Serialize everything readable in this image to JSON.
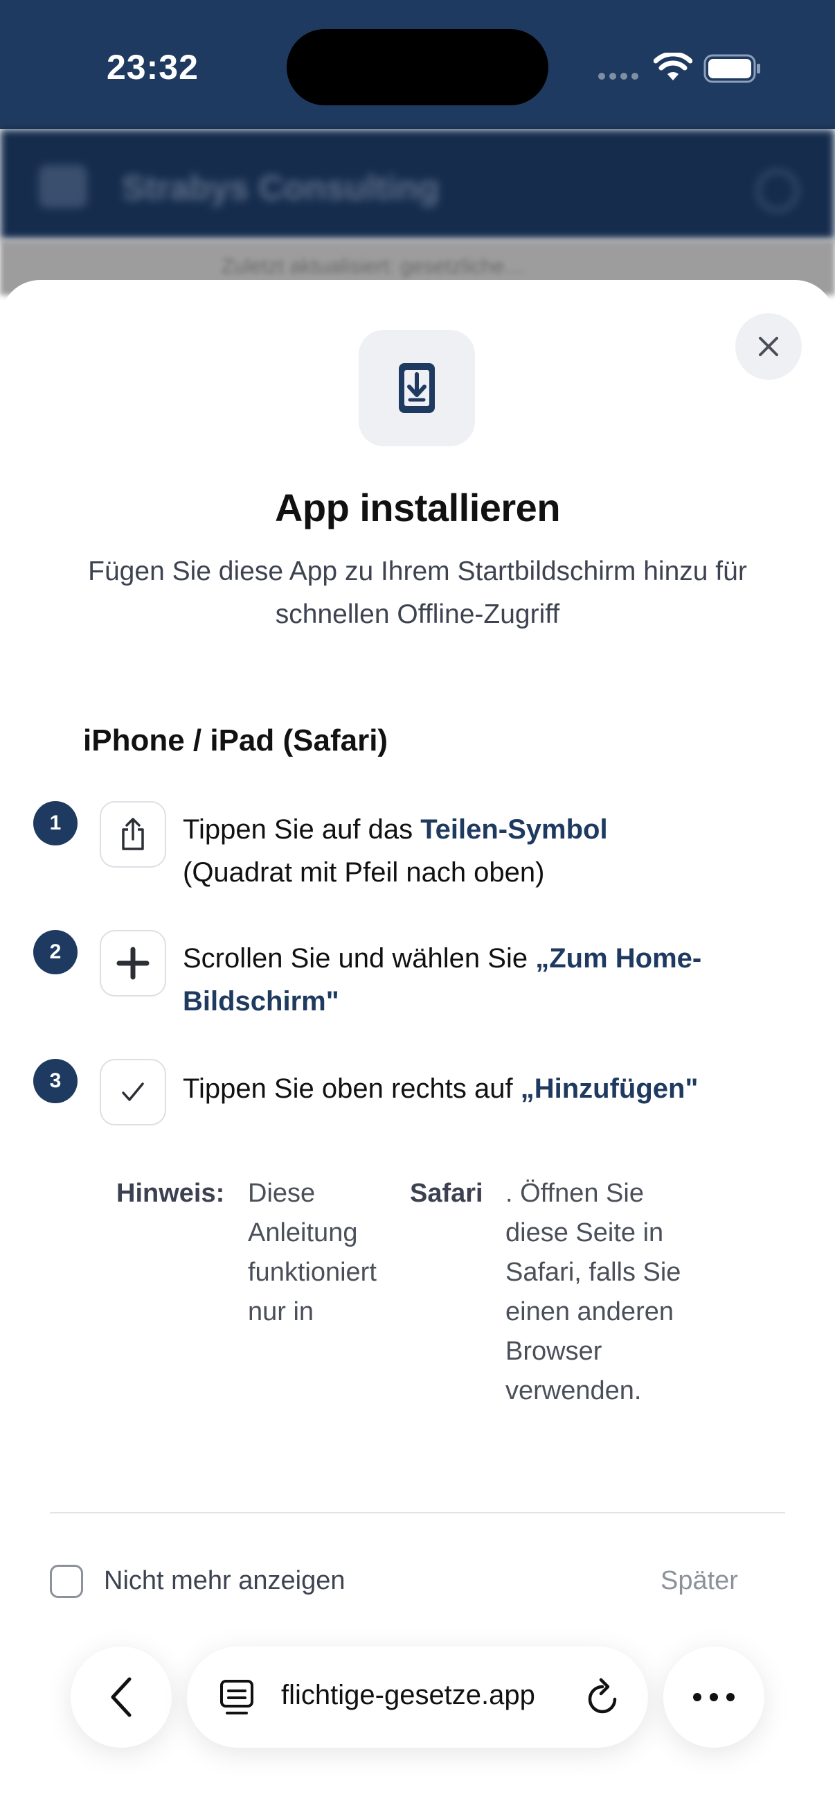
{
  "status_bar": {
    "time": "23:32"
  },
  "background_app": {
    "title": "Strabys Consulting",
    "strip_text": "Zuletzt aktualisiert: gesetzliche…"
  },
  "sheet": {
    "title": "App installieren",
    "subtitle": "Fügen Sie diese App zu Ihrem Startbildschirm hinzu für schnellen Offline-Zugriff",
    "platform_title": "iPhone / iPad (Safari)",
    "steps": [
      {
        "number": "1",
        "icon": "share-icon",
        "text_before": "Tippen Sie auf das ",
        "highlight": "Teilen-Symbol",
        "text_after": "(Quadrat mit Pfeil nach oben)"
      },
      {
        "number": "2",
        "icon": "plus-icon",
        "text_before": "Scrollen Sie und wählen Sie ",
        "highlight": "„Zum Home-Bildschirm\"",
        "text_after": ""
      },
      {
        "number": "3",
        "icon": "checkmark-icon",
        "text_before": "Tippen Sie oben rechts auf ",
        "highlight": "„Hinzufügen\"",
        "text_after": ""
      }
    ],
    "note": {
      "label": "Hinweis:",
      "part1": "Diese Anleitung funktioniert nur in",
      "bold": "Safari",
      "part2": ". Öffnen Sie diese Seite in Safari, falls Sie einen anderen Browser verwenden."
    },
    "checkbox_label": "Nicht mehr anzeigen",
    "checkbox_checked": false,
    "later_label": "Später"
  },
  "browser": {
    "url": "flichtige-gesetze.app"
  },
  "colors": {
    "accent": "#1f3a60",
    "status_bar": "#1f3a60",
    "muted": "#8c919a"
  }
}
